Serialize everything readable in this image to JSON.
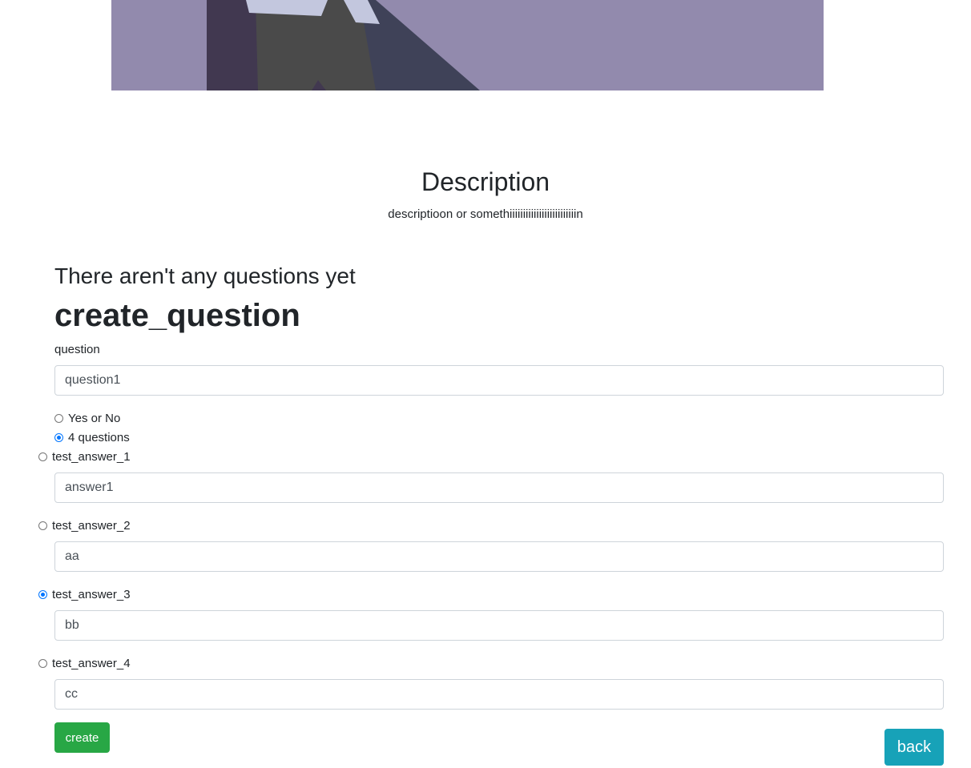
{
  "description_section": {
    "title": "Description",
    "text": "descriptioon or somethiiiiiiiiiiiiiiiiiiiiiiiiin"
  },
  "questions": {
    "empty_message": "There aren't any questions yet"
  },
  "create_form": {
    "heading": "create_question",
    "question_label": "question",
    "question_value": "question1",
    "type_options": [
      {
        "label": "Yes or No",
        "checked": false
      },
      {
        "label": "4 questions",
        "checked": true
      }
    ],
    "answers": [
      {
        "label": "test_answer_1",
        "value": "answer1",
        "correct": false
      },
      {
        "label": "test_answer_2",
        "value": "aa",
        "correct": false
      },
      {
        "label": "test_answer_3",
        "value": "bb",
        "correct": true
      },
      {
        "label": "test_answer_4",
        "value": "cc",
        "correct": false
      }
    ],
    "create_label": "create"
  },
  "navigation": {
    "back_label": "back"
  },
  "colors": {
    "create_button": "#28a745",
    "back_button": "#17a2b8",
    "radio_accent": "#0075ff",
    "hero_background": "#928aad"
  }
}
